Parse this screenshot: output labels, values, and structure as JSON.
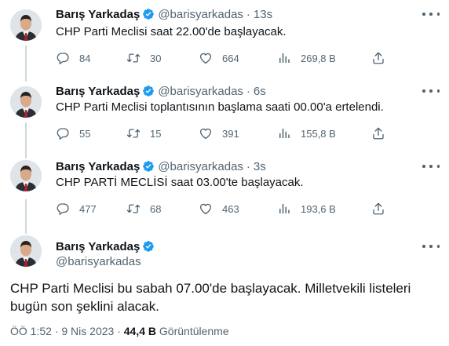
{
  "colors": {
    "verified": "#1d9bf0",
    "text": "#0f1419",
    "muted": "#536471"
  },
  "tweets": [
    {
      "name": "Barış Yarkadaş",
      "handle": "@barisyarkadas",
      "sep": "·",
      "time": "13s",
      "text": "CHP Parti Meclisi saat 22.00'de başlayacak.",
      "replies": "84",
      "retweets": "30",
      "likes": "664",
      "views": "269,8 B"
    },
    {
      "name": "Barış Yarkadaş",
      "handle": "@barisyarkadas",
      "sep": "·",
      "time": "6s",
      "text": "CHP Parti Meclisi toplantısının başlama saati 00.00'a ertelendi.",
      "replies": "55",
      "retweets": "15",
      "likes": "391",
      "views": "155,8 B"
    },
    {
      "name": "Barış Yarkadaş",
      "handle": "@barisyarkadas",
      "sep": "·",
      "time": "3s",
      "text": "CHP PARTİ MECLİSİ saat 03.00'te başlayacak.",
      "replies": "477",
      "retweets": "68",
      "likes": "463",
      "views": "193,6 B"
    }
  ],
  "main": {
    "name": "Barış Yarkadaş",
    "handle": "@barisyarkadas",
    "text": "CHP Parti Meclisi bu sabah 07.00'de başlayacak. Milletvekili listeleri bugün son şeklini alacak.",
    "time": "ÖÖ 1:52",
    "sep": "·",
    "date": "9 Nis 2023",
    "views_count": "44,4 B",
    "views_label": "Görüntülenme"
  }
}
